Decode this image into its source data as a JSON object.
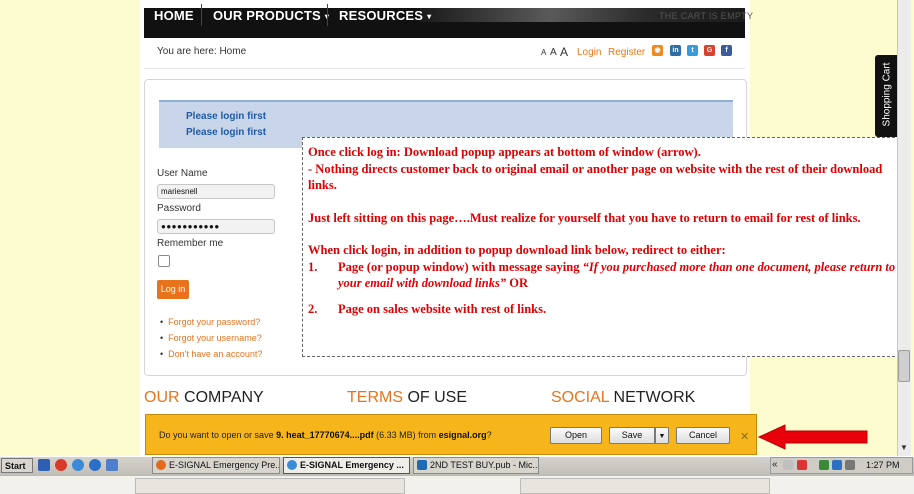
{
  "nav": {
    "items": [
      {
        "label": "HOME",
        "caret": ""
      },
      {
        "label": "OUR PRODUCTS",
        "caret": "▾"
      },
      {
        "label": "RESOURCES",
        "caret": "▾"
      }
    ],
    "cart_status": "THE CART IS EMPTY"
  },
  "breadcrumb": "You are here: Home",
  "toolbar": {
    "font_sizes": [
      "A",
      "A",
      "A"
    ],
    "login_label": "Login",
    "register_label": "Register",
    "social_icons": [
      "rss-icon",
      "linkedin-icon",
      "twitter-icon",
      "google-icon",
      "facebook-icon"
    ]
  },
  "messages": [
    "Please login first",
    "Please login first"
  ],
  "login_form": {
    "username_label": "User Name",
    "username_value": "mariesnell",
    "password_label": "Password",
    "password_value": "●●●●●●●●●●●",
    "remember_label": "Remember me",
    "login_button": "Log in"
  },
  "help_links": [
    "Forgot your password?",
    "Forgot your username?",
    "Don't have an account?"
  ],
  "annotation": {
    "line1": "Once click log in: Download popup appears at bottom of window (arrow).",
    "line2": " - Nothing directs customer back to original email or another page on website with the rest of their download links.",
    "para2": "Just left sitting on this page….Must realize for yourself that you have to return to email for rest of links.",
    "para3": "When click login, in addition to popup download link below, redirect to either:",
    "items": [
      {
        "num": "1.",
        "text": "Page (or popup window) with message saying ",
        "quote": "“If you purchased more than one document, please return to your email with download links”",
        "tail": " OR"
      },
      {
        "num": "2.",
        "text": "Page on sales website with rest of links.",
        "quote": "",
        "tail": ""
      }
    ]
  },
  "footer": {
    "sections": [
      {
        "accent": "OUR",
        "rest": " COMPANY"
      },
      {
        "accent": "TERMS",
        "rest": " OF USE"
      },
      {
        "accent": "SOCIAL",
        "rest": " NETWORK"
      }
    ]
  },
  "download_bar": {
    "prefix": "Do you want to open or save ",
    "filename": "9. heat_17770674....pdf",
    "size": " (6.33 MB) from ",
    "source": "esignal.org",
    "suffix": "?",
    "open_label": "Open",
    "save_label": "Save",
    "cancel_label": "Cancel",
    "close_glyph": "✕"
  },
  "shopping_cart_tab": "Shopping Cart",
  "taskbar": {
    "start_label": "Start",
    "tasks": [
      {
        "label": "E-SIGNAL Emergency Pre...",
        "active": false
      },
      {
        "label": "E-SIGNAL Emergency ...",
        "active": true
      },
      {
        "label": "2ND TEST BUY.pub - Mic...",
        "active": false
      }
    ],
    "tray_chevron": "«",
    "clock": "1:27 PM"
  },
  "colors": {
    "accent_orange": "#e8731d",
    "annotation_red": "#e00000",
    "download_bar": "#f6b51a",
    "arrow_red": "#e8000a",
    "page_background": "#fdfccf"
  }
}
